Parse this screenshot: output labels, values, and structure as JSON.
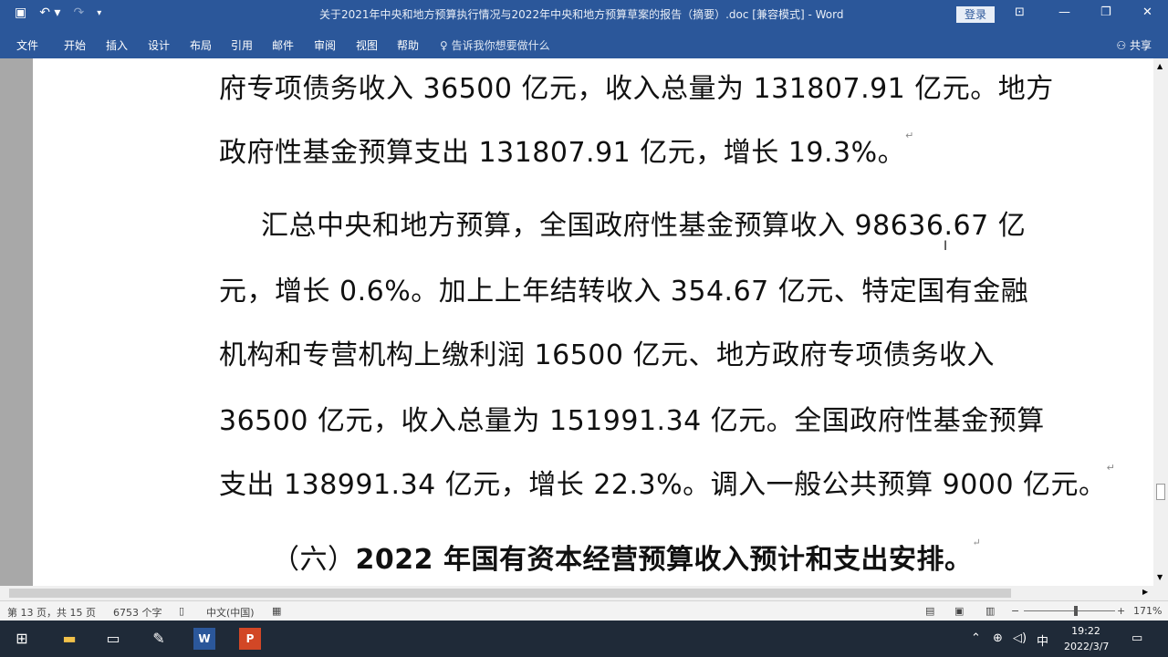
{
  "window": {
    "title": "关于2021年中央和地方预算执行情况与2022年中央和地方预算草案的报告（摘要）.doc [兼容模式] - Word",
    "login_label": "登录"
  },
  "qat": {
    "save_icon": "save-icon",
    "undo_icon": "undo-icon",
    "redo_icon": "redo-icon",
    "customize_icon": "customize-icon"
  },
  "ribbon": {
    "tabs": [
      "文件",
      "开始",
      "插入",
      "设计",
      "布局",
      "引用",
      "邮件",
      "审阅",
      "视图",
      "帮助"
    ],
    "tellme": "告诉我你想要做什么",
    "share": "共享"
  },
  "document": {
    "lines": [
      "府专项债务收入 36500 亿元，收入总量为 131807.91 亿元。地方",
      "政府性基金预算支出 131807.91 亿元，增长 19.3%。",
      "汇总中央和地方预算，全国政府性基金预算收入 98636.67 亿",
      "元，增长 0.6%。加上上年结转收入 354.67 亿元、特定国有金融",
      "机构和专营机构上缴利润 16500 亿元、地方政府专项债务收入",
      "36500 亿元，收入总量为 151991.34 亿元。全国政府性基金预算",
      "支出 138991.34 亿元，增长 22.3%。调入一般公共预算 9000 亿元。"
    ],
    "heading_prefix": "（六）",
    "heading_bold": "2022 年国有资本经营预算收入预计和支出安排。",
    "paragraph_mark": "↵"
  },
  "status": {
    "page": "第 13 页，共 15 页",
    "words": "6753 个字",
    "language": "中文(中国)",
    "zoom": "171%",
    "zoom_value": 171
  },
  "taskbar": {
    "time": "19:22",
    "date": "2022/3/7",
    "ime": "中"
  }
}
